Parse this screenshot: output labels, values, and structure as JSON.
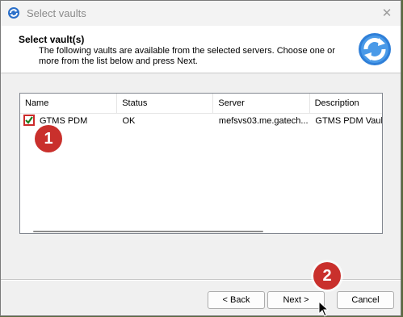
{
  "window": {
    "title": "Select vaults"
  },
  "header": {
    "title": "Select vault(s)",
    "description": "The following vaults are available from the selected servers. Choose one or more from the list below and press Next."
  },
  "list": {
    "columns": [
      "Name",
      "Status",
      "Server",
      "Description"
    ],
    "rows": [
      {
        "checked": true,
        "name": "GTMS PDM",
        "status": "OK",
        "server": "mefsvs03.me.gatech...",
        "description": "GTMS PDM Vault"
      }
    ]
  },
  "annotations": {
    "step1": "1",
    "step2": "2"
  },
  "buttons": {
    "back": "< Back",
    "next": "Next >",
    "cancel": "Cancel"
  },
  "icons": {
    "title_icon": "refresh-app-icon",
    "header_icon": "refresh-sync-icon",
    "close": "close-icon",
    "cursor": "mouse-pointer-icon"
  },
  "colors": {
    "badge": "#c9302c",
    "checkbox_check": "#1e7d1e"
  }
}
